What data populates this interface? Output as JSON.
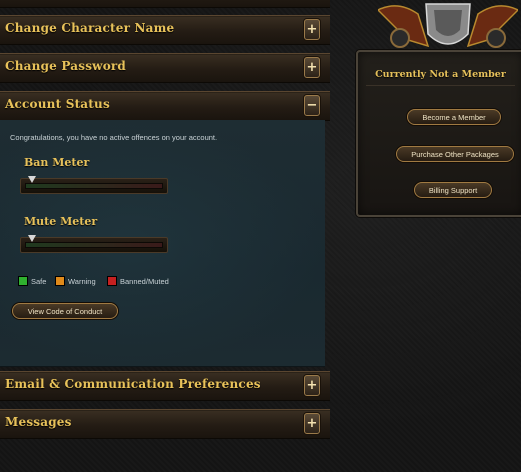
{
  "sections": {
    "change_name": {
      "label": "Change Character Name",
      "toggle": "+"
    },
    "change_password": {
      "label": "Change Password",
      "toggle": "+"
    },
    "account_status": {
      "label": "Account Status",
      "toggle": "−"
    },
    "email_prefs": {
      "label": "Email & Communication Preferences",
      "toggle": "+"
    },
    "messages": {
      "label": "Messages",
      "toggle": "+"
    }
  },
  "account_status": {
    "message": "Congratulations, you have no active offences on your account.",
    "ban_meter": {
      "title": "Ban Meter",
      "level": 0
    },
    "mute_meter": {
      "title": "Mute Meter",
      "level": 0
    },
    "legend": [
      {
        "label": "Safe",
        "color": "#2fb02f"
      },
      {
        "label": "Warning",
        "color": "#e08a1a"
      },
      {
        "label": "Banned/Muted",
        "color": "#c42020"
      }
    ],
    "code_of_conduct_button": "View Code of Conduct"
  },
  "membership": {
    "title": "Currently Not a Member",
    "buttons": [
      "Become a Member",
      "Purchase Other Packages",
      "Billing Support"
    ]
  },
  "colors": {
    "accent_gold": "#e6c15b",
    "panel_teal": "#1e2d33"
  }
}
